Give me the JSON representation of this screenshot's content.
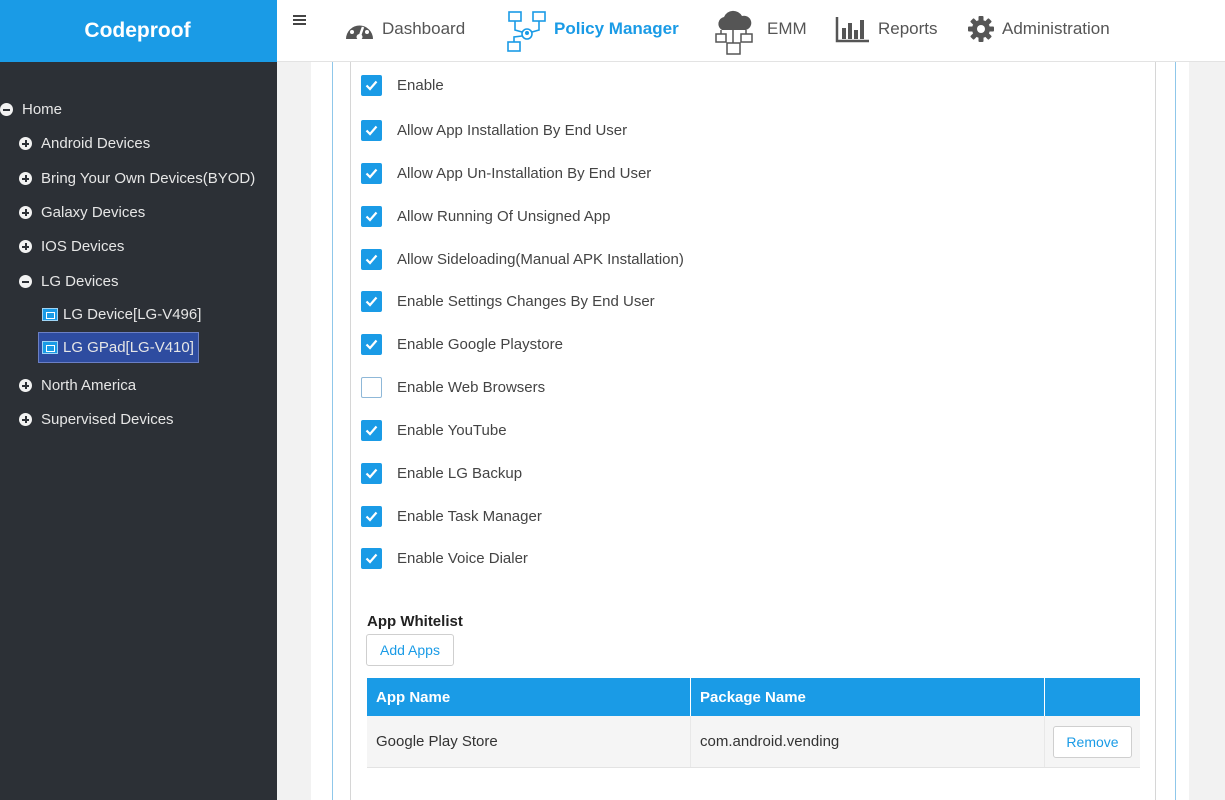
{
  "app": {
    "brand": "Codeproof"
  },
  "sidebar": {
    "items": [
      {
        "label": "Home",
        "icon": "minus-circle-icon"
      },
      {
        "label": "Android Devices",
        "icon": "plus-circle-icon"
      },
      {
        "label": "Bring Your Own Devices(BYOD)",
        "icon": "plus-circle-icon"
      },
      {
        "label": "Galaxy Devices",
        "icon": "plus-circle-icon"
      },
      {
        "label": "IOS Devices",
        "icon": "plus-circle-icon"
      },
      {
        "label": "LG Devices",
        "icon": "minus-circle-icon"
      },
      {
        "label": "LG Device[LG-V496]",
        "icon": "device-icon"
      },
      {
        "label": "LG GPad[LG-V410]",
        "icon": "device-icon",
        "selected": true
      },
      {
        "label": "North America",
        "icon": "plus-circle-icon"
      },
      {
        "label": "Supervised Devices",
        "icon": "plus-circle-icon"
      }
    ]
  },
  "nav": {
    "items": [
      {
        "label": "Dashboard",
        "icon": "dashboard-gauge-icon"
      },
      {
        "label": "Policy Manager",
        "icon": "policy-network-icon",
        "active": true
      },
      {
        "label": "EMM",
        "icon": "cloud-devices-icon"
      },
      {
        "label": "Reports",
        "icon": "bar-chart-icon"
      },
      {
        "label": "Administration",
        "icon": "gear-icon"
      }
    ]
  },
  "settings": [
    {
      "label": "Enable",
      "checked": true
    },
    {
      "label": "Allow App Installation By End User",
      "checked": true
    },
    {
      "label": "Allow App Un-Installation By End User",
      "checked": true
    },
    {
      "label": "Allow Running Of Unsigned App",
      "checked": true
    },
    {
      "label": "Allow Sideloading(Manual APK Installation)",
      "checked": true
    },
    {
      "label": "Enable Settings Changes By End User",
      "checked": true
    },
    {
      "label": "Enable Google Playstore",
      "checked": true
    },
    {
      "label": "Enable Web Browsers",
      "checked": false
    },
    {
      "label": "Enable YouTube",
      "checked": true
    },
    {
      "label": "Enable LG Backup",
      "checked": true
    },
    {
      "label": "Enable Task Manager",
      "checked": true
    },
    {
      "label": "Enable Voice Dialer",
      "checked": true
    }
  ],
  "whitelist": {
    "title": "App Whitelist",
    "add_button": "Add Apps",
    "columns": [
      "App Name",
      "Package Name",
      ""
    ],
    "rows": [
      {
        "app_name": "Google Play Store",
        "package_name": "com.android.vending",
        "action": "Remove"
      }
    ]
  },
  "colors": {
    "accent": "#1a9be6",
    "sidebar_bg": "#2c3036",
    "selected_bg": "#2e4ca0"
  }
}
